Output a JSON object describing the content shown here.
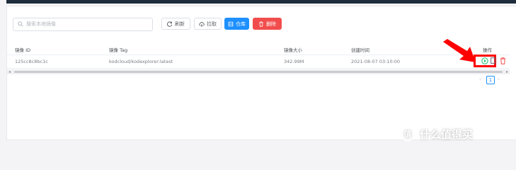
{
  "toolbar": {
    "search_placeholder": "搜索本地镜像",
    "refresh_label": "刷新",
    "pull_label": "拉取",
    "repo_label": "仓库",
    "delete_label": "删除"
  },
  "table": {
    "headers": [
      "镜像 ID",
      "镜像 Tag",
      "镜像大小",
      "创建时间",
      "操作"
    ],
    "rows": [
      {
        "id": "125cc8c8bc1c",
        "tag": "kodcloud/kodexplorer:latest",
        "size": "342.99M",
        "created": "2021-08-07 03:10:00"
      }
    ]
  },
  "pagination": {
    "prev": "‹",
    "current": "1",
    "next": "›"
  },
  "scrollbar": {
    "left": "◂",
    "right": "▸"
  },
  "watermark": {
    "text": "什么值得买"
  },
  "colors": {
    "primary": "#1e90ff",
    "danger": "#f24d4d",
    "run": "#19be6b",
    "highlight": "#ff0000"
  },
  "icons": [
    "search-icon",
    "refresh-icon",
    "cloud-download-icon",
    "repository-icon",
    "trash-icon",
    "play-circle-icon",
    "edit-icon",
    "delete-icon",
    "red-arrow-icon"
  ]
}
